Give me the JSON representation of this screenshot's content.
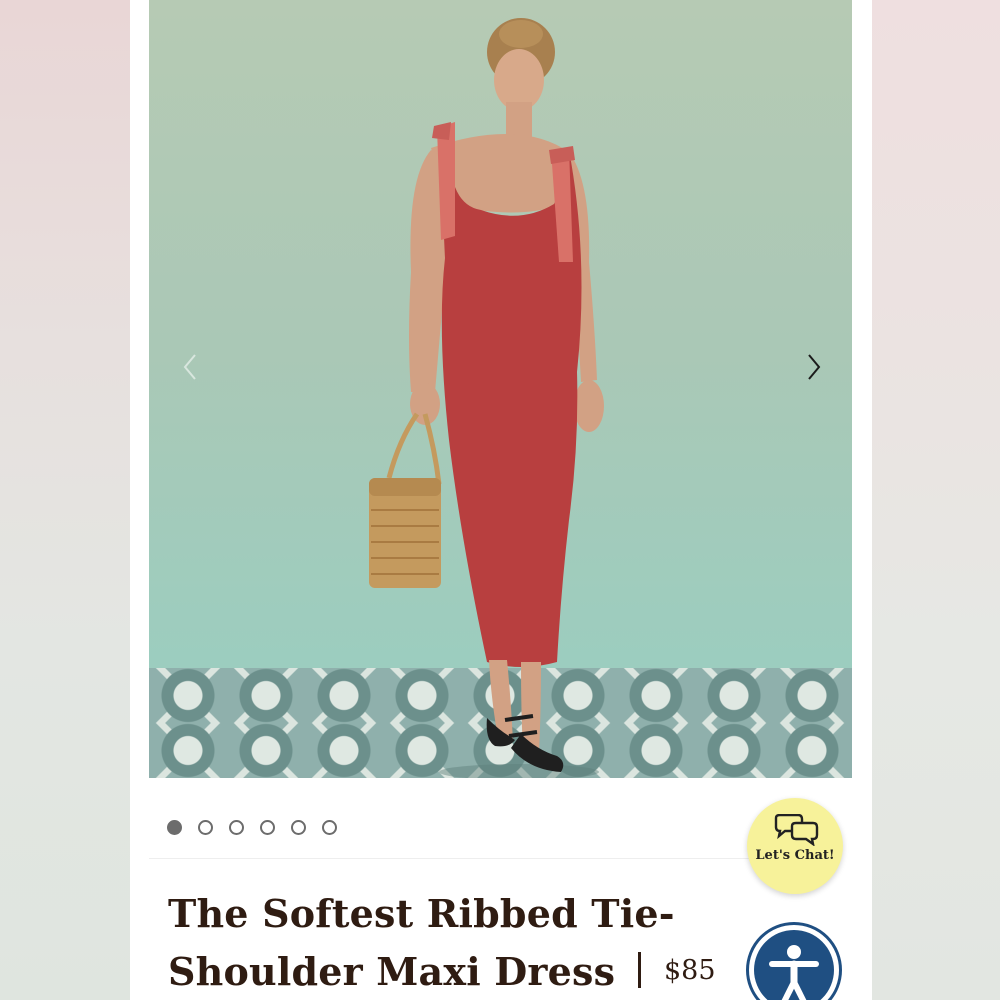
{
  "product": {
    "title": "The Softest Ribbed Tie-Shoulder Maxi Dress",
    "price": "$85",
    "image_alt": "Model wearing red ribbed maxi dress with pink tie shoulders, holding a woven basket bag"
  },
  "carousel": {
    "total_slides": 6,
    "active_slide": 1,
    "prev_icon": "chevron-left-icon",
    "next_icon": "chevron-right-icon"
  },
  "chat": {
    "label": "Let's Chat!",
    "icon": "speech-bubbles-icon",
    "color": "#f7f29a"
  },
  "accessibility": {
    "icon": "accessibility-person-icon",
    "color": "#1f4f82"
  },
  "colors": {
    "text": "#2f1c12",
    "dress": "#b83f3f",
    "straps": "#d97168"
  }
}
